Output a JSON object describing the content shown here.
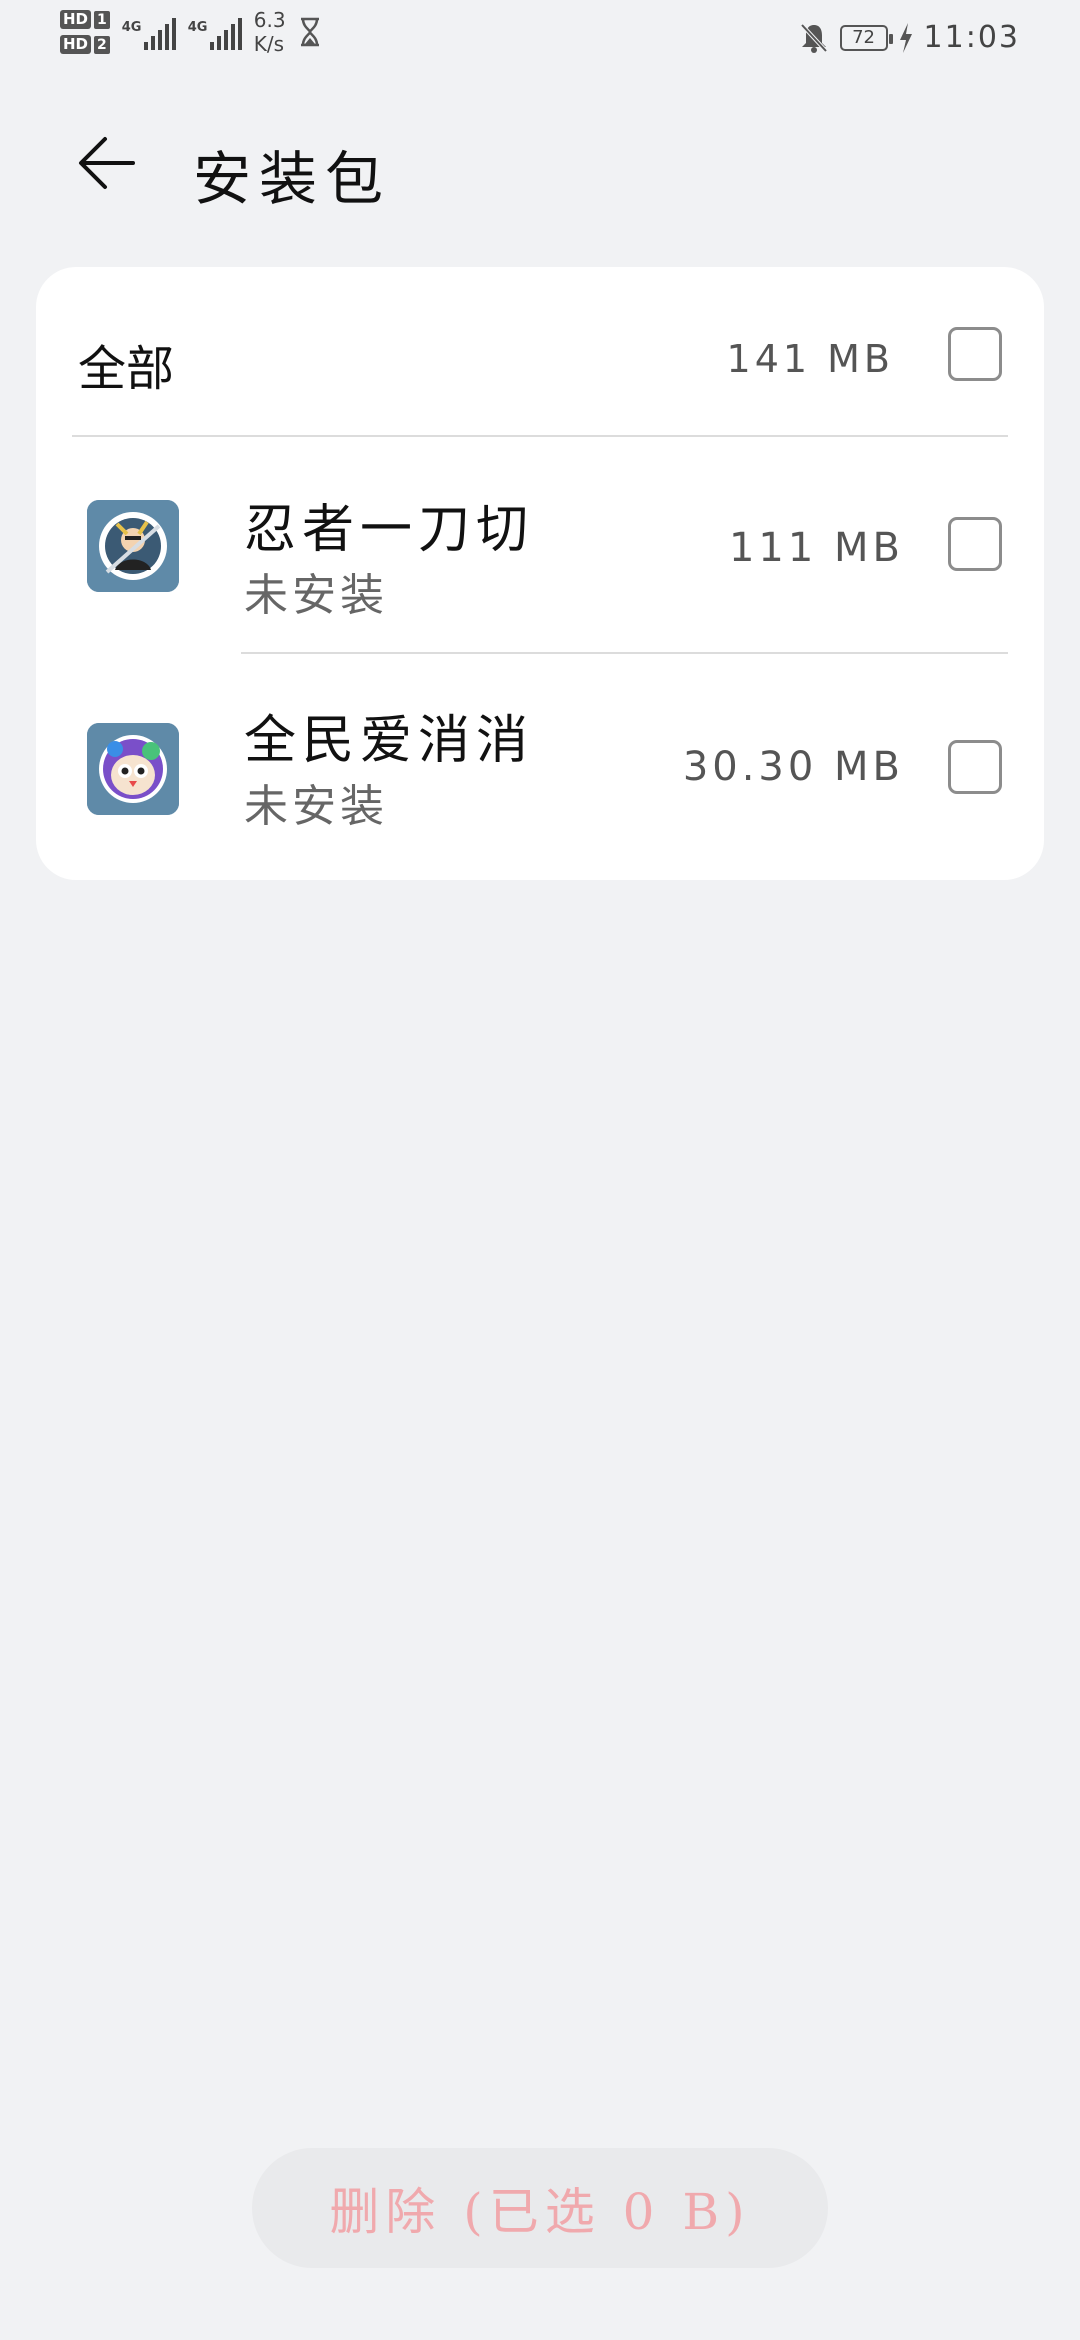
{
  "status_bar": {
    "hd1": "HD",
    "sim1": "1",
    "hd2": "HD",
    "sim2": "2",
    "net1": "4G",
    "net2": "4G",
    "net_speed_value": "6.3",
    "net_speed_unit": "K/s",
    "battery": "72",
    "time": "11:03",
    "icons": [
      "hourglass-icon",
      "bell-off-icon",
      "charging-bolt-icon"
    ]
  },
  "header": {
    "title": "安装包"
  },
  "all_row": {
    "label": "全部",
    "size": "141 MB",
    "checked": false
  },
  "apps": [
    {
      "name": "忍者一刀切",
      "status": "未安装",
      "size": "111 MB",
      "checked": false,
      "icon": "ninja-game-icon"
    },
    {
      "name": "全民爱消消",
      "status": "未安装",
      "size": "30.30 MB",
      "checked": false,
      "icon": "owl-game-icon"
    }
  ],
  "footer": {
    "delete_label": "删除 (已选 0 B)"
  },
  "colors": {
    "background": "#f1f2f4",
    "card": "#ffffff",
    "delete_text": "#f0a9ad"
  }
}
